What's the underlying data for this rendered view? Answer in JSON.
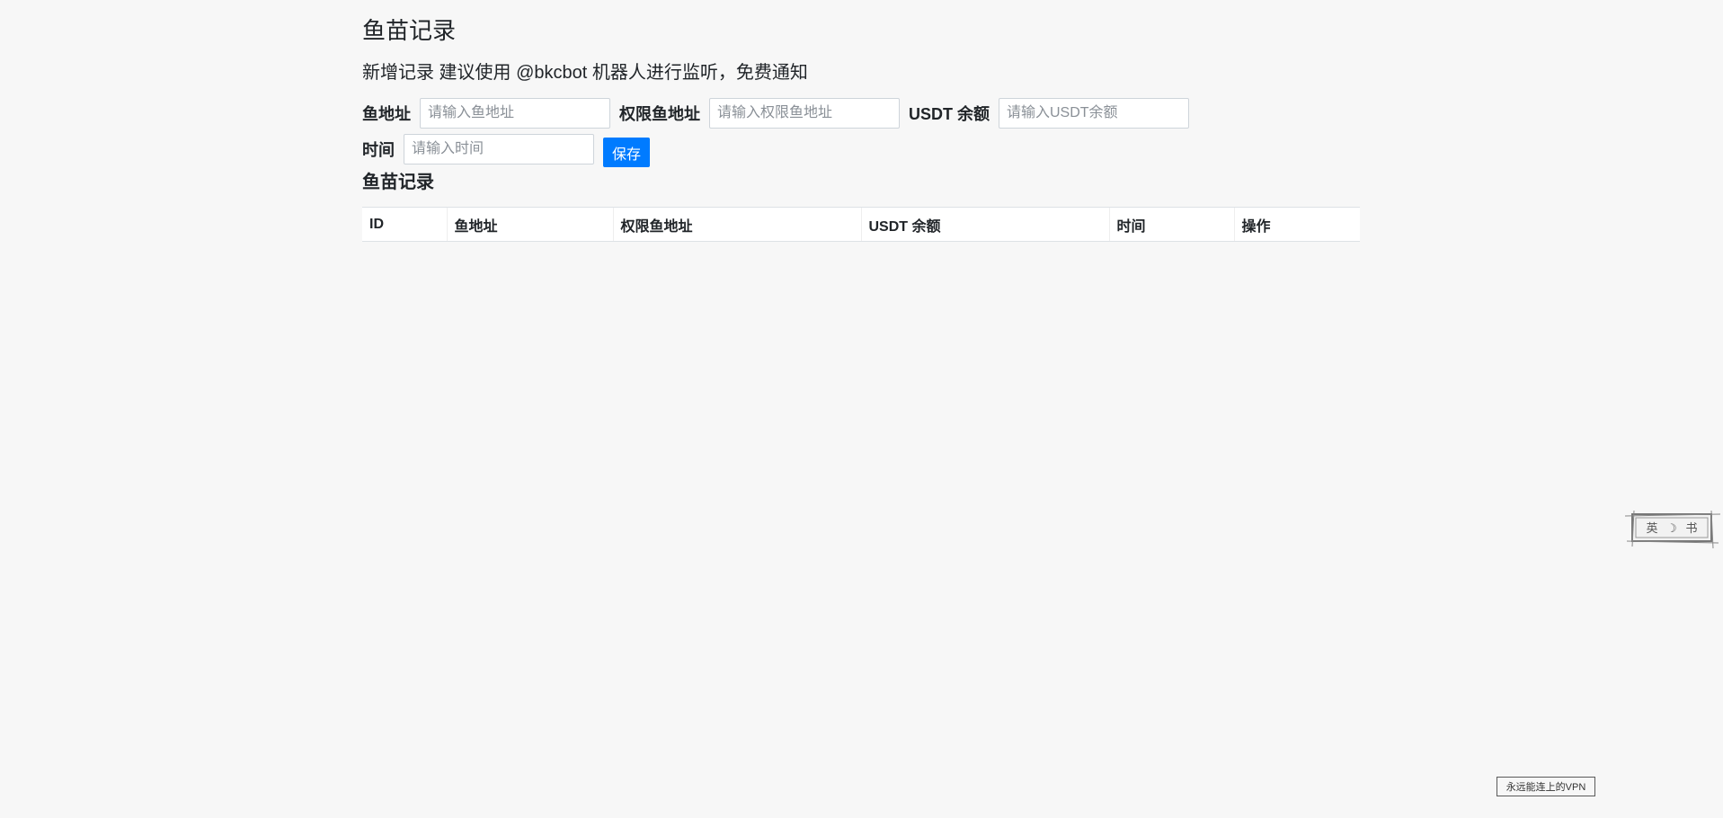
{
  "page_title": "鱼苗记录",
  "subtitle": "新增记录 建议使用 @bkcbot 机器人进行监听，免费通知",
  "form": {
    "fish_address": {
      "label": "鱼地址",
      "placeholder": "请输入鱼地址",
      "value": ""
    },
    "auth_address": {
      "label": "权限鱼地址",
      "placeholder": "请输入权限鱼地址",
      "value": ""
    },
    "usdt_balance": {
      "label": "USDT 余额",
      "placeholder": "请输入USDT余额",
      "value": ""
    },
    "time": {
      "label": "时间",
      "placeholder": "请输入时间",
      "value": ""
    },
    "save_label": "保存"
  },
  "records": {
    "title": "鱼苗记录",
    "columns": [
      "ID",
      "鱼地址",
      "权限鱼地址",
      "USDT 余额",
      "时间",
      "操作"
    ],
    "rows": []
  },
  "translate_widget": {
    "items": [
      "英",
      "☽",
      "书"
    ]
  },
  "vpn_badge": "永远能连上的VPN",
  "colors": {
    "background": "#f7f7f7",
    "primary": "#007bff",
    "text": "#212529"
  }
}
